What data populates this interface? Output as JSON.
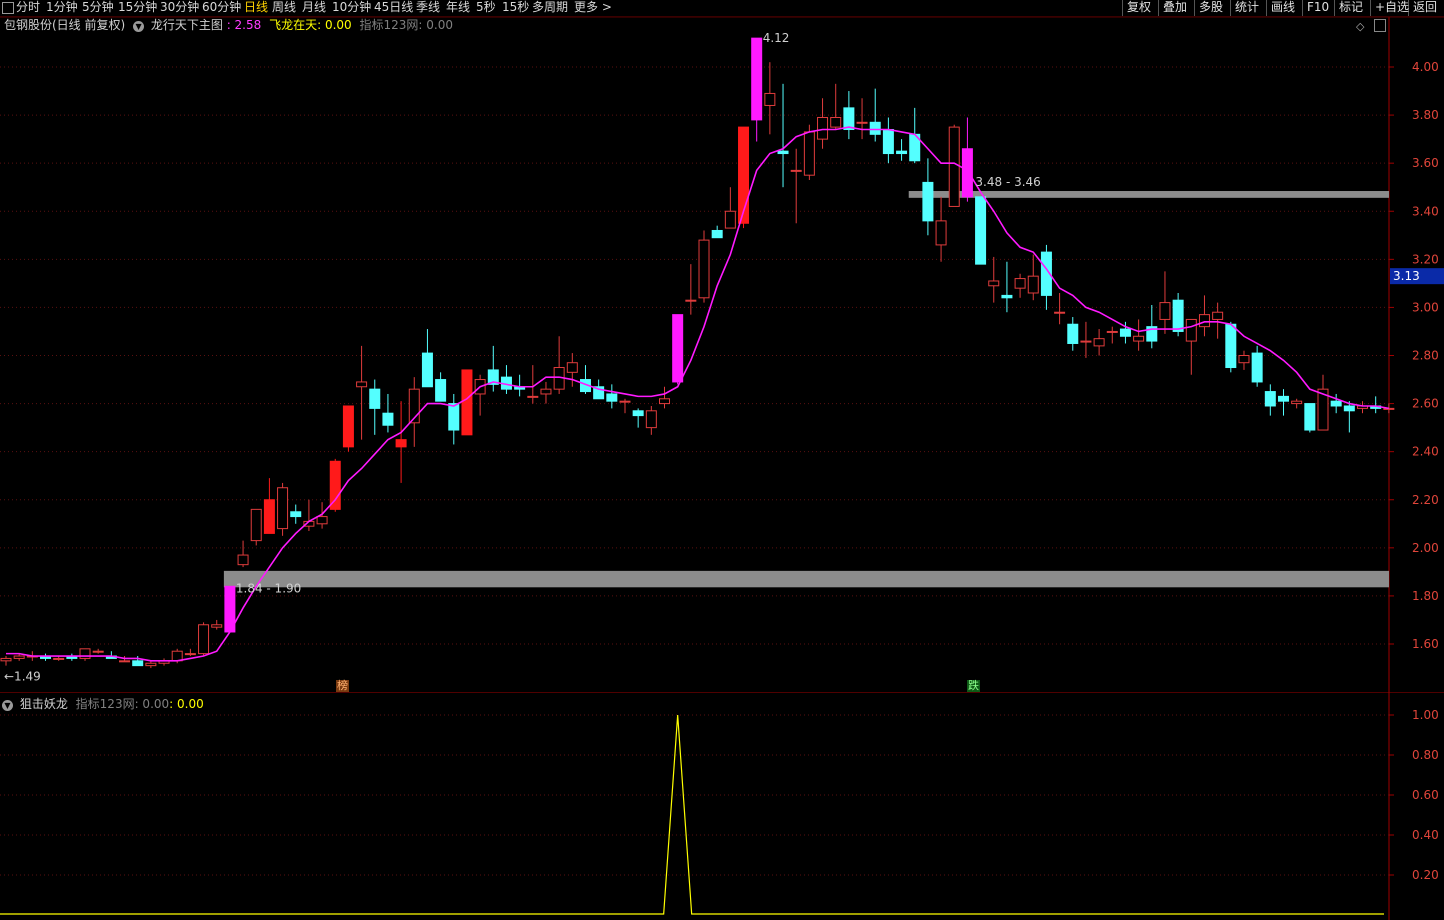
{
  "toolbar": {
    "period_tabs": [
      "分时",
      "1分钟",
      "5分钟",
      "15分钟",
      "30分钟",
      "60分钟",
      "日线",
      "周线",
      "月线",
      "10分钟",
      "45日线",
      "季线",
      "年线",
      "5秒",
      "15秒",
      "多周期",
      "更多 >"
    ],
    "active_tab": "日线",
    "right_buttons": [
      "复权",
      "叠加",
      "多股",
      "统计",
      "画线",
      "F10",
      "标记",
      "+自选",
      "返回"
    ]
  },
  "main_legend": {
    "stock": "包钢股份(日线 前复权)",
    "indicator_name": "龙行天下主图",
    "indicator_value": ": 2.58",
    "line2_label": "飞龙在天: ",
    "line2_value": "0.00",
    "line3": "指标123网: 0.00",
    "colors": {
      "value": "#ff3cff",
      "line2": "#ffff00",
      "line3": "#808080"
    }
  },
  "sub_legend": {
    "name": "狙击妖龙",
    "line1": "指标123网: 0.00",
    "line2": ": 0.00",
    "colors": {
      "line1": "#808080",
      "line2": "#ffff00"
    }
  },
  "annotations": {
    "high_label": "4.12",
    "low_label": "←1.49",
    "band_low_label": "1.84 - 1.90",
    "band_high_label": "3.48 - 3.46",
    "current_price_tag": "3.13",
    "signal_buy": "榜",
    "signal_sell": "跌"
  },
  "chart_data": [
    {
      "type": "candlestick",
      "title": "包钢股份(日线 前复权)",
      "yticks": [
        1.6,
        1.8,
        2.0,
        2.2,
        2.4,
        2.6,
        2.8,
        3.0,
        3.2,
        3.4,
        3.6,
        3.8,
        4.0
      ],
      "ylim": [
        1.4,
        4.2
      ],
      "grid": true,
      "colors": {
        "up": "#e03c3c",
        "down": "#54ffff",
        "ma": "#ff1aff",
        "band": "#8c8c8c",
        "limit_up": "#ff1a1a",
        "strong": "#ff1aff"
      },
      "candles": [
        [
          1.53,
          1.55,
          1.51,
          1.54
        ],
        [
          1.54,
          1.56,
          1.53,
          1.55
        ],
        [
          1.55,
          1.57,
          1.53,
          1.55
        ],
        [
          1.55,
          1.56,
          1.53,
          1.54
        ],
        [
          1.54,
          1.55,
          1.53,
          1.54
        ],
        [
          1.55,
          1.56,
          1.53,
          1.54
        ],
        [
          1.54,
          1.58,
          1.53,
          1.58
        ],
        [
          1.57,
          1.58,
          1.56,
          1.57
        ],
        [
          1.55,
          1.57,
          1.54,
          1.54
        ],
        [
          1.53,
          1.55,
          1.53,
          1.53
        ],
        [
          1.53,
          1.55,
          1.51,
          1.51
        ],
        [
          1.51,
          1.53,
          1.5,
          1.52
        ],
        [
          1.52,
          1.54,
          1.51,
          1.53
        ],
        [
          1.53,
          1.58,
          1.52,
          1.57
        ],
        [
          1.56,
          1.58,
          1.55,
          1.56
        ],
        [
          1.56,
          1.69,
          1.55,
          1.68
        ],
        [
          1.67,
          1.7,
          1.66,
          1.68
        ],
        [
          1.65,
          1.84,
          1.65,
          1.84
        ],
        [
          1.93,
          2.03,
          1.92,
          1.97
        ],
        [
          2.03,
          2.16,
          2.01,
          2.16
        ],
        [
          2.2,
          2.29,
          2.06,
          2.06
        ],
        [
          2.08,
          2.27,
          2.05,
          2.25
        ],
        [
          2.15,
          2.18,
          2.1,
          2.13
        ],
        [
          2.09,
          2.2,
          2.07,
          2.11
        ],
        [
          2.1,
          2.19,
          2.08,
          2.13
        ],
        [
          2.16,
          2.37,
          2.15,
          2.36
        ],
        [
          2.42,
          2.59,
          2.4,
          2.59
        ],
        [
          2.67,
          2.84,
          2.45,
          2.69
        ],
        [
          2.66,
          2.7,
          2.47,
          2.58
        ],
        [
          2.56,
          2.64,
          2.48,
          2.51
        ],
        [
          2.45,
          2.61,
          2.27,
          2.42
        ],
        [
          2.52,
          2.71,
          2.42,
          2.66
        ],
        [
          2.81,
          2.91,
          2.67,
          2.67
        ],
        [
          2.7,
          2.73,
          2.62,
          2.61
        ],
        [
          2.6,
          2.64,
          2.43,
          2.49
        ],
        [
          2.47,
          2.74,
          2.47,
          2.74
        ],
        [
          2.64,
          2.72,
          2.55,
          2.7
        ],
        [
          2.74,
          2.84,
          2.65,
          2.68
        ],
        [
          2.71,
          2.76,
          2.64,
          2.66
        ],
        [
          2.67,
          2.72,
          2.63,
          2.66
        ],
        [
          2.63,
          2.76,
          2.6,
          2.63
        ],
        [
          2.64,
          2.69,
          2.6,
          2.66
        ],
        [
          2.66,
          2.88,
          2.64,
          2.75
        ],
        [
          2.73,
          2.81,
          2.67,
          2.77
        ],
        [
          2.7,
          2.76,
          2.64,
          2.65
        ],
        [
          2.67,
          2.7,
          2.62,
          2.62
        ],
        [
          2.64,
          2.68,
          2.58,
          2.61
        ],
        [
          2.61,
          2.62,
          2.56,
          2.61
        ],
        [
          2.57,
          2.58,
          2.5,
          2.55
        ],
        [
          2.5,
          2.59,
          2.47,
          2.57
        ],
        [
          2.6,
          2.67,
          2.58,
          2.62
        ],
        [
          2.69,
          2.97,
          2.68,
          2.97
        ],
        [
          3.03,
          3.18,
          2.97,
          3.03
        ],
        [
          3.04,
          3.32,
          3.02,
          3.28
        ],
        [
          3.32,
          3.34,
          3.29,
          3.29
        ],
        [
          3.33,
          3.5,
          3.35,
          3.4
        ],
        [
          3.35,
          3.75,
          3.33,
          3.75
        ],
        [
          4.12,
          4.12,
          3.69,
          3.78
        ],
        [
          3.84,
          4.02,
          3.72,
          3.89
        ],
        [
          3.65,
          3.93,
          3.5,
          3.64
        ],
        [
          3.57,
          3.66,
          3.35,
          3.57
        ],
        [
          3.55,
          3.76,
          3.53,
          3.73
        ],
        [
          3.7,
          3.87,
          3.66,
          3.79
        ],
        [
          3.75,
          3.93,
          3.74,
          3.79
        ],
        [
          3.83,
          3.9,
          3.7,
          3.74
        ],
        [
          3.77,
          3.87,
          3.7,
          3.77
        ],
        [
          3.77,
          3.91,
          3.69,
          3.72
        ],
        [
          3.74,
          3.79,
          3.6,
          3.64
        ],
        [
          3.65,
          3.7,
          3.61,
          3.64
        ],
        [
          3.72,
          3.83,
          3.6,
          3.61
        ],
        [
          3.52,
          3.62,
          3.3,
          3.36
        ],
        [
          3.26,
          3.46,
          3.19,
          3.36
        ],
        [
          3.42,
          3.76,
          3.42,
          3.75
        ],
        [
          3.66,
          3.79,
          3.44,
          3.46
        ],
        [
          3.46,
          3.46,
          3.18,
          3.18
        ],
        [
          3.09,
          3.21,
          3.02,
          3.11
        ],
        [
          3.05,
          3.19,
          2.98,
          3.04
        ],
        [
          3.08,
          3.14,
          3.04,
          3.12
        ],
        [
          3.06,
          3.22,
          3.03,
          3.13
        ],
        [
          3.23,
          3.26,
          2.99,
          3.05
        ],
        [
          2.98,
          3.06,
          2.93,
          2.98
        ],
        [
          2.93,
          2.96,
          2.82,
          2.85
        ],
        [
          2.86,
          2.94,
          2.79,
          2.86
        ],
        [
          2.84,
          2.91,
          2.8,
          2.87
        ],
        [
          2.9,
          2.92,
          2.85,
          2.9
        ],
        [
          2.91,
          2.94,
          2.85,
          2.88
        ],
        [
          2.86,
          2.95,
          2.82,
          2.88
        ],
        [
          2.92,
          3.01,
          2.83,
          2.86
        ],
        [
          2.95,
          3.15,
          2.89,
          3.02
        ],
        [
          3.03,
          3.06,
          2.88,
          2.9
        ],
        [
          2.86,
          2.93,
          2.72,
          2.95
        ],
        [
          2.92,
          3.05,
          2.88,
          2.97
        ],
        [
          2.95,
          3.02,
          2.87,
          2.98
        ],
        [
          2.93,
          2.94,
          2.73,
          2.75
        ],
        [
          2.77,
          2.82,
          2.74,
          2.8
        ],
        [
          2.81,
          2.84,
          2.67,
          2.69
        ],
        [
          2.65,
          2.68,
          2.55,
          2.59
        ],
        [
          2.63,
          2.66,
          2.55,
          2.61
        ],
        [
          2.6,
          2.62,
          2.58,
          2.61
        ],
        [
          2.6,
          2.59,
          2.48,
          2.49
        ],
        [
          2.49,
          2.72,
          2.49,
          2.66
        ],
        [
          2.61,
          2.64,
          2.56,
          2.59
        ],
        [
          2.59,
          2.61,
          2.48,
          2.57
        ],
        [
          2.58,
          2.61,
          2.56,
          2.59
        ],
        [
          2.59,
          2.63,
          2.56,
          2.58
        ],
        [
          2.58,
          2.6,
          2.56,
          2.58
        ]
      ],
      "ma": [
        1.56,
        1.56,
        1.55,
        1.55,
        1.55,
        1.55,
        1.55,
        1.55,
        1.55,
        1.54,
        1.54,
        1.53,
        1.53,
        1.53,
        1.54,
        1.55,
        1.57,
        1.65,
        1.75,
        1.84,
        1.92,
        2.0,
        2.06,
        2.11,
        2.14,
        2.2,
        2.28,
        2.33,
        2.39,
        2.45,
        2.48,
        2.54,
        2.6,
        2.6,
        2.59,
        2.62,
        2.67,
        2.69,
        2.68,
        2.67,
        2.67,
        2.71,
        2.71,
        2.7,
        2.68,
        2.66,
        2.65,
        2.64,
        2.63,
        2.63,
        2.64,
        2.67,
        2.78,
        2.92,
        3.09,
        3.22,
        3.4,
        3.57,
        3.64,
        3.66,
        3.71,
        3.73,
        3.74,
        3.74,
        3.75,
        3.74,
        3.74,
        3.74,
        3.73,
        3.72,
        3.66,
        3.6,
        3.6,
        3.57,
        3.48,
        3.4,
        3.31,
        3.25,
        3.23,
        3.16,
        3.08,
        3.05,
        3.0,
        2.98,
        2.95,
        2.92,
        2.9,
        2.91,
        2.91,
        2.91,
        2.92,
        2.94,
        2.94,
        2.93,
        2.88,
        2.85,
        2.82,
        2.78,
        2.73,
        2.66,
        2.64,
        2.62,
        2.6,
        2.59,
        2.59,
        2.58
      ],
      "bands": [
        {
          "from_index": 17,
          "to_index": 105,
          "low": 1.84,
          "high": 1.9
        },
        {
          "from_index": 69,
          "to_index": 105,
          "low": 3.46,
          "high": 3.48
        }
      ],
      "current_price": 3.13
    },
    {
      "type": "line",
      "title": "狙击妖龙",
      "yticks": [
        0.2,
        0.4,
        0.6,
        0.8,
        1.0
      ],
      "ylim": [
        0.0,
        1.0
      ],
      "grid": true,
      "series": [
        {
          "name": "指标123网",
          "color": "#ffff00",
          "spike_index": 51,
          "values_note": "0 everywhere except 1.00 at spike"
        }
      ]
    }
  ]
}
